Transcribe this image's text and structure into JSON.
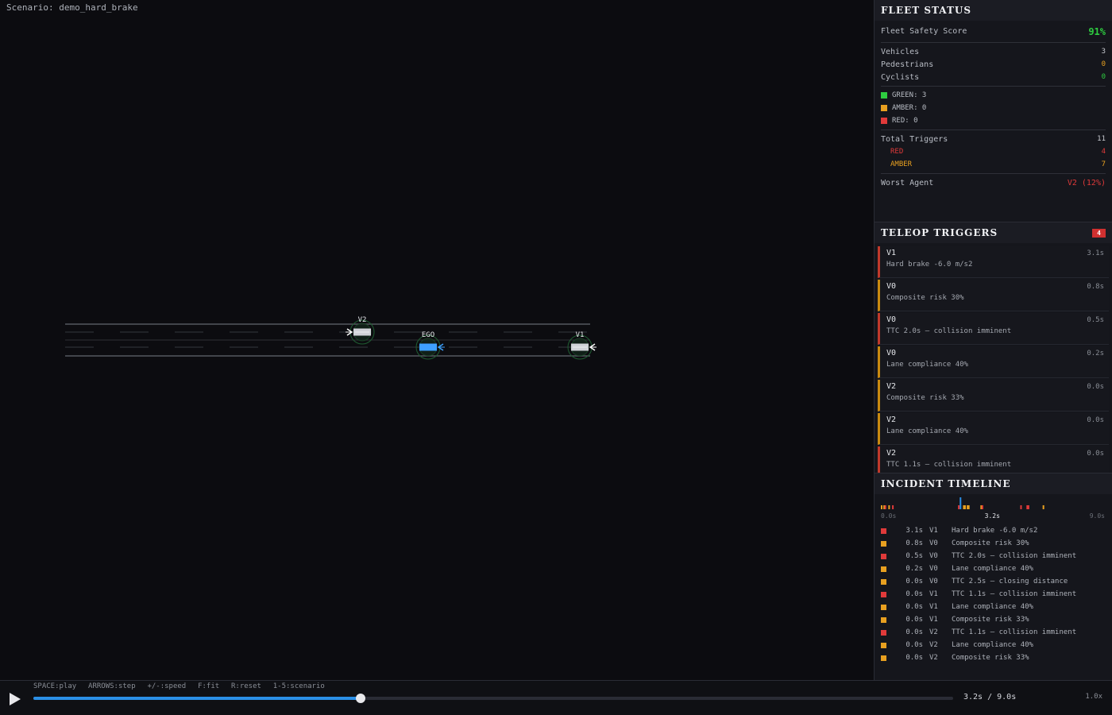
{
  "scenario_label": "Scenario: demo_hard_brake",
  "colors": {
    "red": "#e03a3a",
    "amber": "#e8a020",
    "green": "#2ecc40",
    "ego": "#3ea0ff",
    "vehicle": "#d0d2d8",
    "playhead": "#2b8fe6"
  },
  "scene": {
    "agents": [
      {
        "id": "V2",
        "label": "V2",
        "kind": "vehicle"
      },
      {
        "id": "EGO",
        "label": "EGO",
        "kind": "ego"
      },
      {
        "id": "V1",
        "label": "V1",
        "kind": "vehicle"
      }
    ]
  },
  "fleet": {
    "title": "FLEET STATUS",
    "score_label": "Fleet Safety Score",
    "score_value": "91%",
    "vehicles_label": "Vehicles",
    "vehicles_value": "3",
    "pedestrians_label": "Pedestrians",
    "pedestrians_value": "0",
    "cyclists_label": "Cyclists",
    "cyclists_value": "0",
    "green_label": "GREEN: 3",
    "amber_label": "AMBER: 0",
    "red_label": "RED: 0",
    "total_triggers_label": "Total Triggers",
    "total_triggers_value": "11",
    "red_triggers_label": "RED",
    "red_triggers_value": "4",
    "amber_triggers_label": "AMBER",
    "amber_triggers_value": "7",
    "worst_agent_label": "Worst Agent",
    "worst_agent_value": "V2 (12%)"
  },
  "triggers": {
    "title": "TELEOP TRIGGERS",
    "badge": "4",
    "items": [
      {
        "agent": "V1",
        "time": "3.1s",
        "msg": "Hard brake -6.0 m/s2",
        "level": "red"
      },
      {
        "agent": "V0",
        "time": "0.8s",
        "msg": "Composite risk 30%",
        "level": "amber"
      },
      {
        "agent": "V0",
        "time": "0.5s",
        "msg": "TTC 2.0s — collision imminent",
        "level": "red"
      },
      {
        "agent": "V0",
        "time": "0.2s",
        "msg": "Lane compliance 40%",
        "level": "amber"
      },
      {
        "agent": "V2",
        "time": "0.0s",
        "msg": "Composite risk 33%",
        "level": "amber"
      },
      {
        "agent": "V2",
        "time": "0.0s",
        "msg": "Lane compliance 40%",
        "level": "amber"
      },
      {
        "agent": "V2",
        "time": "0.0s",
        "msg": "TTC 1.1s — collision imminent",
        "level": "red"
      }
    ]
  },
  "timeline": {
    "title": "INCIDENT TIMELINE",
    "start_label": "0.0s",
    "end_label": "9.0s",
    "current_label": "3.2s",
    "duration": 9.0,
    "current": 3.2,
    "ticks": [
      {
        "t": 0.0,
        "level": "amber"
      },
      {
        "t": 0.1,
        "level": "amber"
      },
      {
        "t": 0.15,
        "level": "red"
      },
      {
        "t": 0.3,
        "level": "amber"
      },
      {
        "t": 0.45,
        "level": "red"
      },
      {
        "t": 3.1,
        "level": "red"
      },
      {
        "t": 3.3,
        "level": "amber"
      },
      {
        "t": 3.35,
        "level": "amber"
      },
      {
        "t": 3.45,
        "level": "amber"
      },
      {
        "t": 3.5,
        "level": "amber"
      },
      {
        "t": 4.0,
        "level": "amber"
      },
      {
        "t": 4.05,
        "level": "red"
      },
      {
        "t": 5.6,
        "level": "red"
      },
      {
        "t": 5.85,
        "level": "red"
      },
      {
        "t": 5.9,
        "level": "red"
      },
      {
        "t": 6.5,
        "level": "amber"
      }
    ],
    "items": [
      {
        "time": "3.1s",
        "agent": "V1",
        "msg": "Hard brake -6.0 m/s2",
        "level": "red"
      },
      {
        "time": "0.8s",
        "agent": "V0",
        "msg": "Composite risk 30%",
        "level": "amber"
      },
      {
        "time": "0.5s",
        "agent": "V0",
        "msg": "TTC 2.0s — collision imminent",
        "level": "red"
      },
      {
        "time": "0.2s",
        "agent": "V0",
        "msg": "Lane compliance 40%",
        "level": "amber"
      },
      {
        "time": "0.0s",
        "agent": "V0",
        "msg": "TTC 2.5s — closing distance",
        "level": "amber"
      },
      {
        "time": "0.0s",
        "agent": "V1",
        "msg": "TTC 1.1s — collision imminent",
        "level": "red"
      },
      {
        "time": "0.0s",
        "agent": "V1",
        "msg": "Lane compliance 40%",
        "level": "amber"
      },
      {
        "time": "0.0s",
        "agent": "V1",
        "msg": "Composite risk 33%",
        "level": "amber"
      },
      {
        "time": "0.0s",
        "agent": "V2",
        "msg": "TTC 1.1s — collision imminent",
        "level": "red"
      },
      {
        "time": "0.0s",
        "agent": "V2",
        "msg": "Lane compliance 40%",
        "level": "amber"
      },
      {
        "time": "0.0s",
        "agent": "V2",
        "msg": "Composite risk 33%",
        "level": "amber"
      }
    ]
  },
  "controls": {
    "hints": "SPACE:play  ARROWS:step  +/-:speed  F:fit  R:reset  1-5:scenario",
    "time_readout": "3.2s / 9.0s",
    "speed": "1.0x",
    "progress": 0.356
  }
}
